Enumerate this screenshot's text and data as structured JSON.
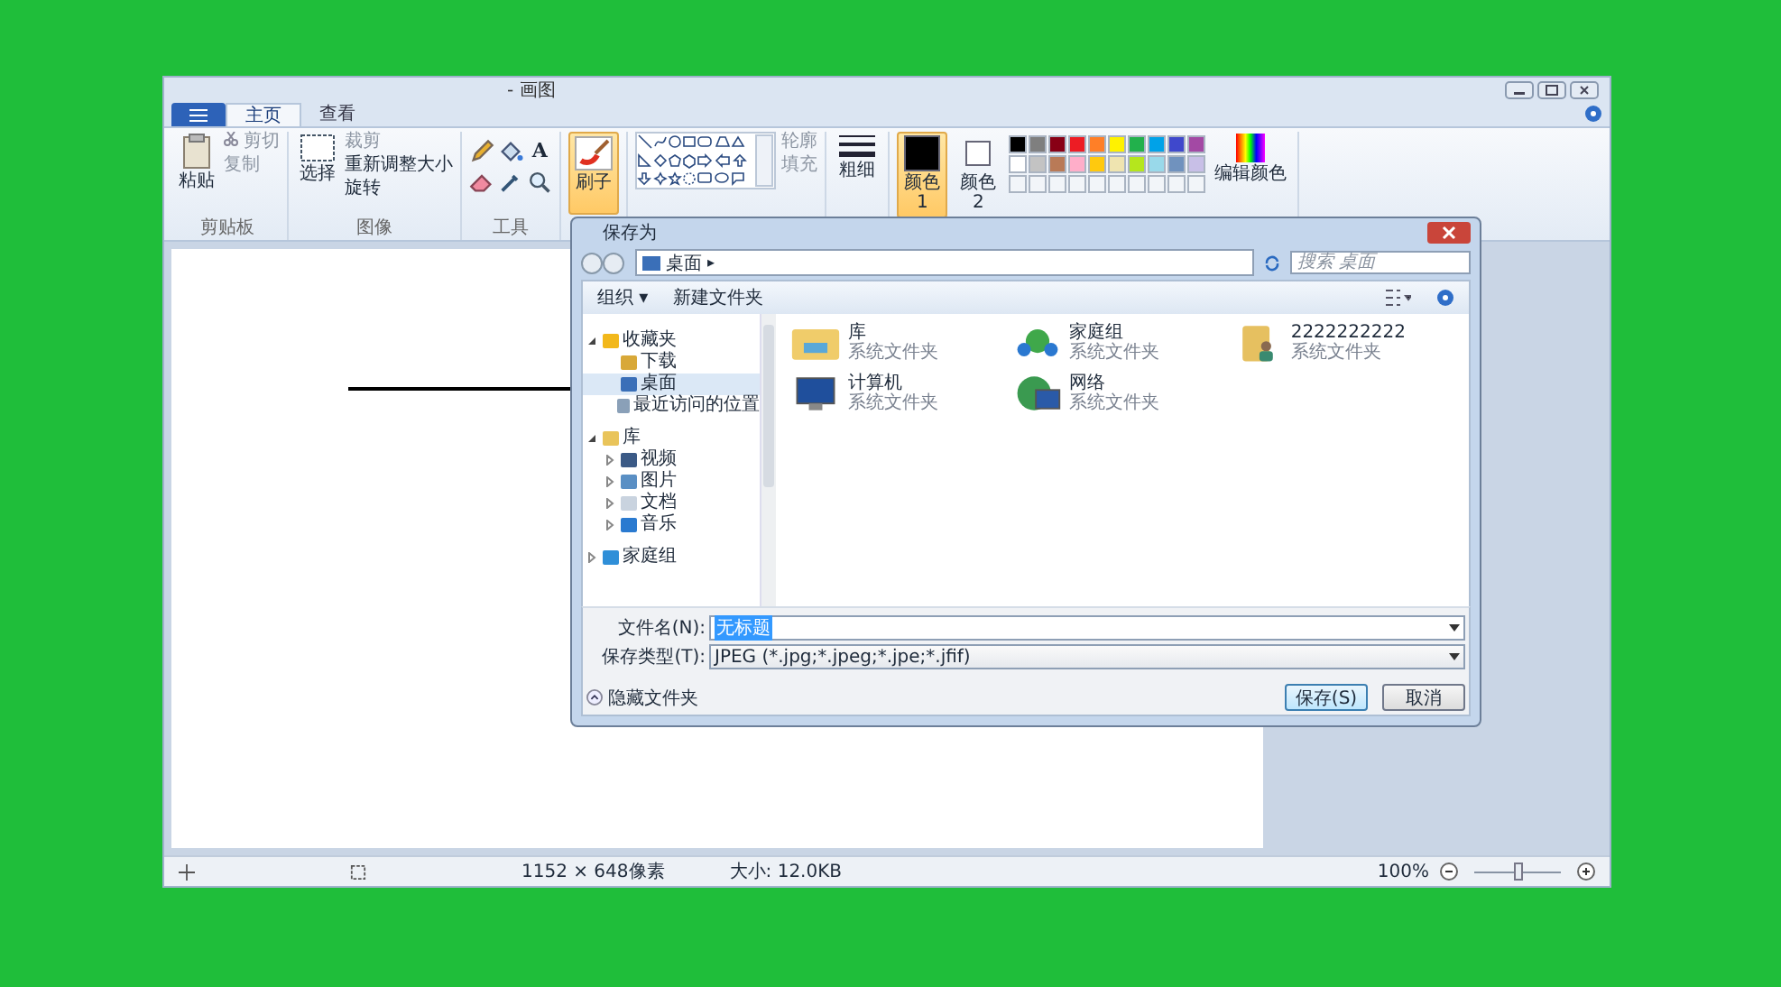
{
  "paint": {
    "title": "- 画图",
    "tabs": [
      {
        "label": "主页",
        "selected": true
      },
      {
        "label": "查看",
        "selected": false
      }
    ],
    "clipboard": {
      "paste": "粘贴",
      "cut": "剪切",
      "copy": "复制",
      "label": "剪贴板"
    },
    "image": {
      "select": "选择",
      "crop": "裁剪",
      "resize": "重新调整大小",
      "rotate": "旋转",
      "label": "图像"
    },
    "tools": {
      "text_tool": "A",
      "label": "工具"
    },
    "brush": {
      "label": "刷子",
      "selected": true
    },
    "outline": "轮廓",
    "fill": "填充",
    "size": "粗细",
    "color1": {
      "label": "颜色 1",
      "color": "#000000",
      "selected": true
    },
    "color2": {
      "label": "颜色 2",
      "color": "#ffffff",
      "selected": false
    },
    "palette": [
      {
        "color": "#000000"
      },
      {
        "color": "#7f7f7f"
      },
      {
        "color": "#880015"
      },
      {
        "color": "#ed1c24"
      },
      {
        "color": "#ff7f27"
      },
      {
        "color": "#fff200"
      },
      {
        "color": "#22b14c"
      },
      {
        "color": "#00a2e8"
      },
      {
        "color": "#3f48cc"
      },
      {
        "color": "#a349a4"
      },
      {
        "color": "#ffffff"
      },
      {
        "color": "#c3c3c3"
      },
      {
        "color": "#b97a57"
      },
      {
        "color": "#ffaec9"
      },
      {
        "color": "#ffc90e"
      },
      {
        "color": "#efe4b0"
      },
      {
        "color": "#b5e61d"
      },
      {
        "color": "#99d9ea"
      },
      {
        "color": "#7092be"
      },
      {
        "color": "#c8bfe7"
      }
    ],
    "edit_colors": "编辑颜色",
    "status_bar": {
      "dimensions": "1152 × 648像素",
      "file_size": "大小: 12.0KB",
      "zoom": "100%",
      "zoom_slider": {
        "level": 0.5
      }
    }
  },
  "dialog": {
    "title": "保存为",
    "address": "桌面",
    "address_arrow": "▸",
    "search": {
      "placeholder": "搜索 桌面"
    },
    "toolbar": {
      "organize": "组织 ▾",
      "new_folder": "新建文件夹"
    },
    "tree": [
      {
        "label": "收藏夹",
        "kind": "star",
        "expanded": true,
        "selected": false,
        "children": [
          {
            "label": "下载",
            "kind": "download",
            "selected": false
          },
          {
            "label": "桌面",
            "kind": "desktop",
            "selected": true
          },
          {
            "label": "最近访问的位置",
            "kind": "recent",
            "selected": false
          }
        ]
      },
      {
        "label": "库",
        "kind": "library",
        "expanded": true,
        "selected": false,
        "children": [
          {
            "label": "视频",
            "kind": "video",
            "expanded": false,
            "selected": false
          },
          {
            "label": "图片",
            "kind": "pictures",
            "expanded": false,
            "selected": false
          },
          {
            "label": "文档",
            "kind": "documents",
            "expanded": false,
            "selected": false
          },
          {
            "label": "音乐",
            "kind": "music",
            "expanded": false,
            "selected": false
          }
        ]
      },
      {
        "label": "家庭组",
        "kind": "homegroup",
        "expanded": false,
        "selected": false
      }
    ],
    "items": [
      {
        "name": "库",
        "type": "系统文件夹",
        "kind": "library"
      },
      {
        "name": "家庭组",
        "type": "系统文件夹",
        "kind": "homegroup"
      },
      {
        "name": "2222222222",
        "type": "系统文件夹",
        "kind": "user"
      },
      {
        "name": "计算机",
        "type": "系统文件夹",
        "kind": "computer"
      },
      {
        "name": "网络",
        "type": "系统文件夹",
        "kind": "network"
      }
    ],
    "file_name": {
      "label": "文件名(N):",
      "value": "无标题"
    },
    "file_type": {
      "label": "保存类型(T):",
      "value": "JPEG (*.jpg;*.jpeg;*.jpe;*.jfif)"
    },
    "hide_folders": "隐藏文件夹",
    "save": "保存(S)",
    "cancel": "取消"
  }
}
